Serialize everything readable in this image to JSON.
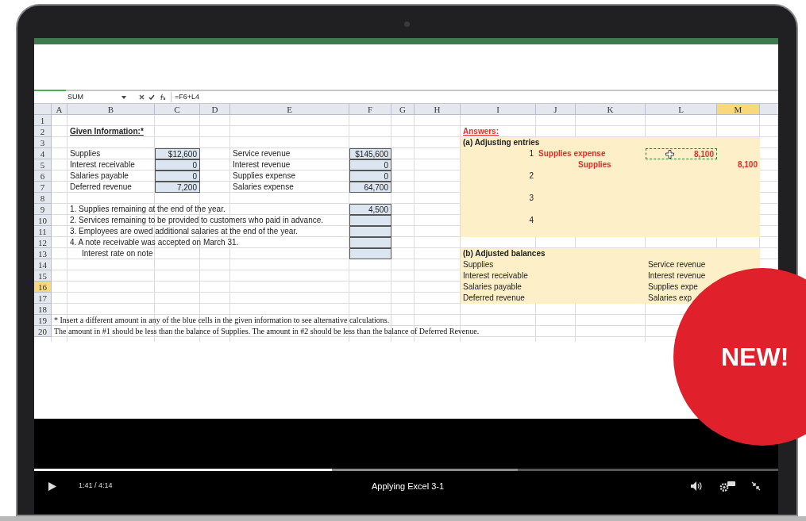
{
  "formula_bar": {
    "name_box": "SUM",
    "formula": "=F6+L4"
  },
  "columns": [
    {
      "label": "A",
      "selected": false
    },
    {
      "label": "B",
      "selected": false
    },
    {
      "label": "C",
      "selected": false
    },
    {
      "label": "D",
      "selected": false
    },
    {
      "label": "E",
      "selected": false
    },
    {
      "label": "F",
      "selected": false
    },
    {
      "label": "G",
      "selected": false
    },
    {
      "label": "H",
      "selected": false
    },
    {
      "label": "I",
      "selected": false
    },
    {
      "label": "J",
      "selected": false
    },
    {
      "label": "K",
      "selected": false
    },
    {
      "label": "L",
      "selected": false
    },
    {
      "label": "M",
      "selected": true
    }
  ],
  "rows": [
    {
      "number": "1",
      "selected": false
    },
    {
      "number": "2",
      "selected": false,
      "cells": [
        null,
        {
          "kind": "heading",
          "text": "Given Information:*"
        },
        null,
        null,
        null,
        null,
        null,
        null,
        {
          "kind": "answers",
          "text": "Answers:"
        }
      ]
    },
    {
      "number": "3",
      "selected": false,
      "cells": [
        null,
        null,
        null,
        null,
        null,
        null,
        null,
        null,
        {
          "kind": "bold",
          "text": "(a) Adjusting entries"
        }
      ]
    },
    {
      "number": "4",
      "selected": false,
      "cells": [
        null,
        {
          "kind": "label",
          "text": "Supplies"
        },
        {
          "kind": "input",
          "text": "$12,600"
        },
        null,
        {
          "kind": "label",
          "text": "Service revenue"
        },
        {
          "kind": "input",
          "text": "$145,600"
        },
        null,
        null,
        {
          "kind": "index",
          "text": "1"
        },
        {
          "kind": "red",
          "text": "Supplies expense"
        },
        null,
        {
          "kind": "red_copy",
          "text": "8,100"
        }
      ]
    },
    {
      "number": "5",
      "selected": false,
      "cells": [
        null,
        {
          "kind": "label",
          "text": "Interest receivable"
        },
        {
          "kind": "input",
          "text": "0"
        },
        null,
        {
          "kind": "label",
          "text": "Interest revenue"
        },
        {
          "kind": "input",
          "text": "0"
        },
        null,
        null,
        null,
        null,
        {
          "kind": "red",
          "text": "Supplies"
        },
        null,
        {
          "kind": "red_amount",
          "text": "8,100"
        }
      ]
    },
    {
      "number": "6",
      "selected": false,
      "cells": [
        null,
        {
          "kind": "label",
          "text": "Salaries payable"
        },
        {
          "kind": "input",
          "text": "0"
        },
        null,
        {
          "kind": "label",
          "text": "Supplies expense"
        },
        {
          "kind": "input",
          "text": "0"
        },
        null,
        null,
        {
          "kind": "index",
          "text": "2"
        }
      ]
    },
    {
      "number": "7",
      "selected": false,
      "cells": [
        null,
        {
          "kind": "label",
          "text": "Deferred revenue"
        },
        {
          "kind": "input",
          "text": "7,200"
        },
        null,
        {
          "kind": "label",
          "text": "Salaries expense"
        },
        {
          "kind": "input",
          "text": "64,700"
        }
      ]
    },
    {
      "number": "8",
      "selected": false,
      "cells": [
        null,
        null,
        null,
        null,
        null,
        null,
        null,
        null,
        {
          "kind": "index",
          "text": "3"
        }
      ]
    },
    {
      "number": "9",
      "selected": false,
      "cells": [
        null,
        {
          "kind": "label",
          "text": "1. Supplies remaining at the end of the year."
        },
        null,
        null,
        null,
        {
          "kind": "input",
          "text": "4,500"
        }
      ]
    },
    {
      "number": "10",
      "selected": false,
      "cells": [
        null,
        {
          "kind": "label",
          "text": "2. Services remaining to be provided to customers who paid in advance."
        },
        null,
        null,
        null,
        {
          "kind": "input"
        },
        null,
        null,
        {
          "kind": "index",
          "text": "4"
        }
      ]
    },
    {
      "number": "11",
      "selected": false,
      "cells": [
        null,
        {
          "kind": "label",
          "text": "3. Employees are owed additional salaries at the end of the year."
        },
        null,
        null,
        null,
        {
          "kind": "input"
        }
      ]
    },
    {
      "number": "12",
      "selected": false,
      "cells": [
        null,
        {
          "kind": "label",
          "text": "4. A note receivable was accepted on March 31."
        },
        null,
        null,
        null,
        {
          "kind": "input"
        }
      ]
    },
    {
      "number": "13",
      "selected": false,
      "cells": [
        null,
        {
          "kind": "indented",
          "text": "Interest rate on note"
        },
        null,
        null,
        null,
        {
          "kind": "input"
        },
        null,
        null,
        {
          "kind": "bold",
          "text": "(b) Adjusted balances"
        }
      ]
    },
    {
      "number": "14",
      "selected": false,
      "cells": [
        null,
        null,
        null,
        null,
        null,
        null,
        null,
        null,
        {
          "kind": "label",
          "text": "Supplies"
        },
        null,
        null,
        {
          "kind": "label",
          "text": "Service revenue"
        }
      ]
    },
    {
      "number": "15",
      "selected": false,
      "cells": [
        null,
        null,
        null,
        null,
        null,
        null,
        null,
        null,
        {
          "kind": "label",
          "text": "Interest receivable"
        },
        null,
        null,
        {
          "kind": "label",
          "text": "Interest revenue"
        }
      ]
    },
    {
      "number": "16",
      "selected": true,
      "cells": [
        null,
        null,
        null,
        null,
        null,
        null,
        null,
        null,
        {
          "kind": "label",
          "text": "Salaries payable"
        },
        null,
        null,
        {
          "kind": "label",
          "text": "Supplies expe"
        }
      ]
    },
    {
      "number": "17",
      "selected": false,
      "cells": [
        null,
        null,
        null,
        null,
        null,
        null,
        null,
        null,
        {
          "kind": "label",
          "text": "Deferred revenue"
        },
        null,
        null,
        {
          "kind": "label",
          "text": "Salaries exp"
        }
      ]
    },
    {
      "number": "18",
      "selected": false
    },
    {
      "number": "19",
      "selected": false,
      "cells": [
        {
          "kind": "note",
          "text": "* Insert a different amount in any of the blue cells in the given information to see alternative calculations."
        }
      ]
    },
    {
      "number": "20",
      "selected": false,
      "cells": [
        {
          "kind": "note",
          "text": "The amount in #1 should be less than the balance of Supplies. The amount in #2 should be less than the balance of Deferred Revenue."
        }
      ]
    }
  ],
  "video": {
    "time": "1:41 / 4:14",
    "title": "Applying Excel 3-1",
    "level": 0.4
  },
  "badge": "NEW!"
}
